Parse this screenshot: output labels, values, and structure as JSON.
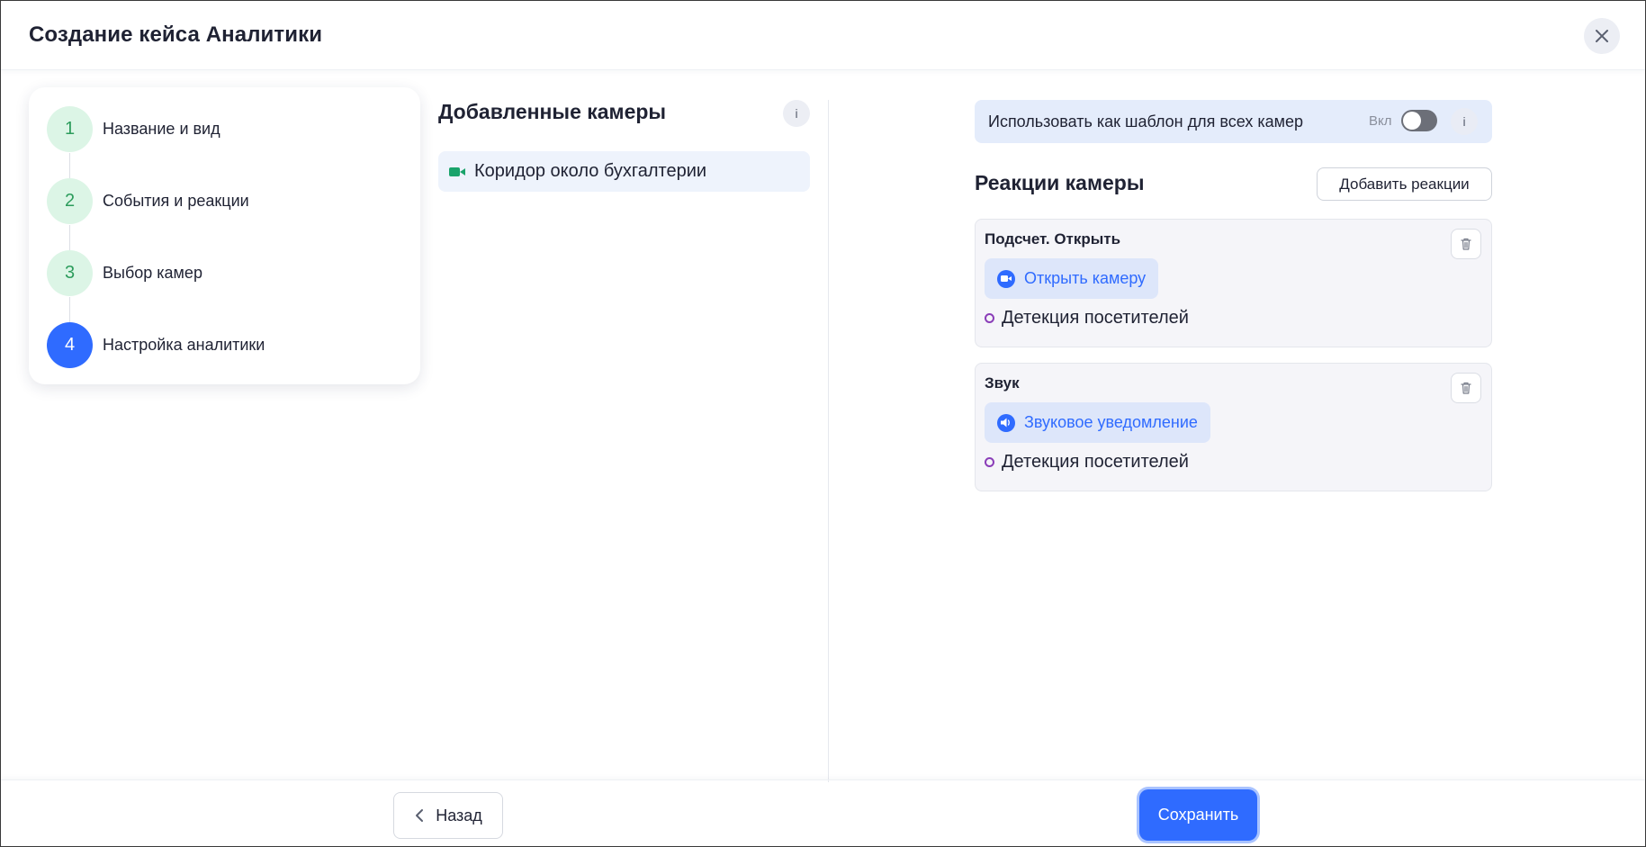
{
  "header": {
    "title": "Создание кейса Аналитики",
    "close_icon": "close-icon"
  },
  "stepper": {
    "steps": [
      {
        "number": "1",
        "label": "Название и вид",
        "state": "done"
      },
      {
        "number": "2",
        "label": "События и реакции",
        "state": "done"
      },
      {
        "number": "3",
        "label": "Выбор камер",
        "state": "done"
      },
      {
        "number": "4",
        "label": "Настройка аналитики",
        "state": "active"
      }
    ]
  },
  "cameras": {
    "title": "Добавленные камеры",
    "info_label": "i",
    "items": [
      {
        "label": "Коридор около бухгалтерии",
        "icon": "video-camera-icon"
      }
    ]
  },
  "template": {
    "label": "Использовать как шаблон для всех камер",
    "toggle_label": "Вкл",
    "toggle_on": false,
    "info_label": "i"
  },
  "reactions": {
    "title": "Реакции камеры",
    "add_button_label": "Добавить реакции",
    "cards": [
      {
        "name": "Подсчет. Открыть",
        "action_label": "Открыть камеру",
        "action_icon": "video-camera-icon",
        "event_label": "Детекция посетителей"
      },
      {
        "name": "Звук",
        "action_label": "Звуковое уведомление",
        "action_icon": "speaker-icon",
        "event_label": "Детекция посетителей"
      }
    ]
  },
  "footer": {
    "back_label": "Назад",
    "save_label": "Сохранить"
  },
  "colors": {
    "accent": "#2f6bff",
    "step_done_bg": "#dcf5e6",
    "step_done_text": "#2c9c5c",
    "event_ring": "#8a3db8"
  }
}
